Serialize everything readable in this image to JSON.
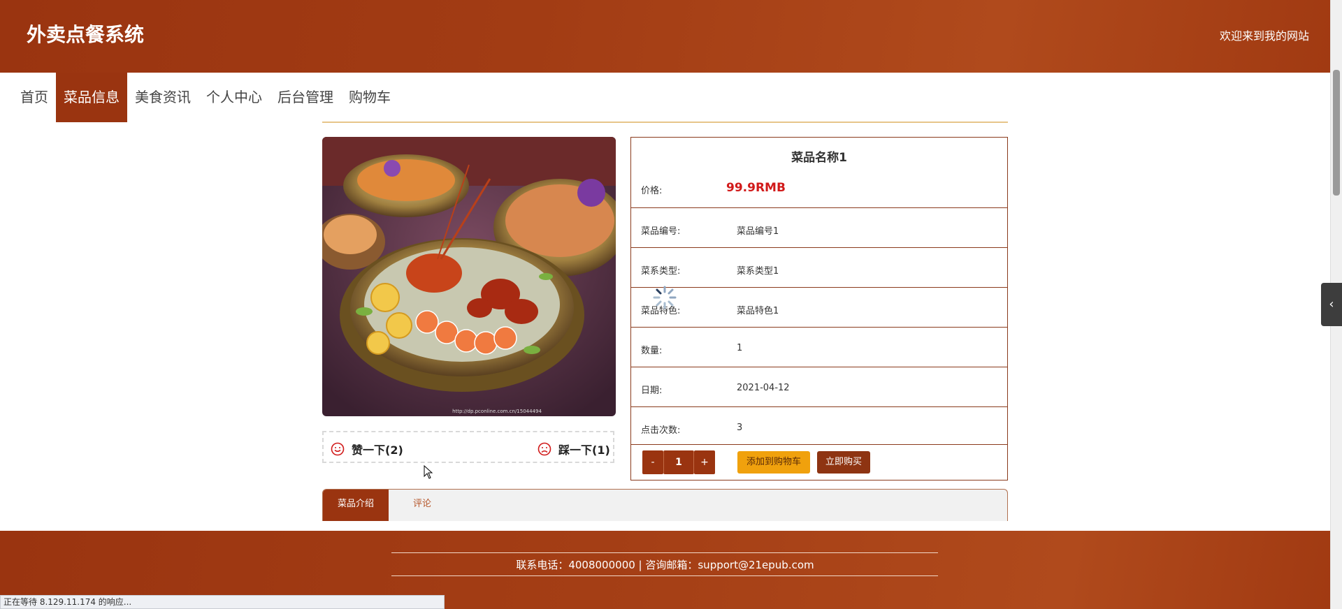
{
  "header": {
    "title": "外卖点餐系统",
    "welcome": "欢迎来到我的网站"
  },
  "nav": {
    "items": [
      {
        "label": "首页"
      },
      {
        "label": "菜品信息",
        "active": true
      },
      {
        "label": "美食资讯"
      },
      {
        "label": "个人中心"
      },
      {
        "label": "后台管理"
      },
      {
        "label": "购物车"
      }
    ]
  },
  "votes": {
    "like_label": "赞一下(2)",
    "dislike_label": "踩一下(1)"
  },
  "product": {
    "name": "菜品名称1",
    "price_label": "价格:",
    "price": "99.9RMB",
    "fields": [
      {
        "label": "菜品编号:",
        "value": "菜品编号1"
      },
      {
        "label": "菜系类型:",
        "value": "菜系类型1"
      },
      {
        "label": "菜品特色:",
        "value": "菜品特色1"
      },
      {
        "label": "数量:",
        "value": "1"
      },
      {
        "label": "日期:",
        "value": "2021-04-12"
      },
      {
        "label": "点击次数:",
        "value": "3"
      }
    ],
    "quantity": {
      "minus": "-",
      "value": "1",
      "plus": "+"
    },
    "add_to_cart": "添加到购物车",
    "buy_now": "立即购买"
  },
  "tabs": [
    {
      "label": "菜品介绍",
      "active": true
    },
    {
      "label": "评论"
    }
  ],
  "footer": {
    "contact": "联系电话：4008000000 | 咨询邮箱：support@21epub.com"
  },
  "status_bar": "正在等待 8.129.11.174 的响应...",
  "colors": {
    "brand": "#9a3410",
    "accent": "#f0a10d",
    "price": "#d11a1a"
  }
}
